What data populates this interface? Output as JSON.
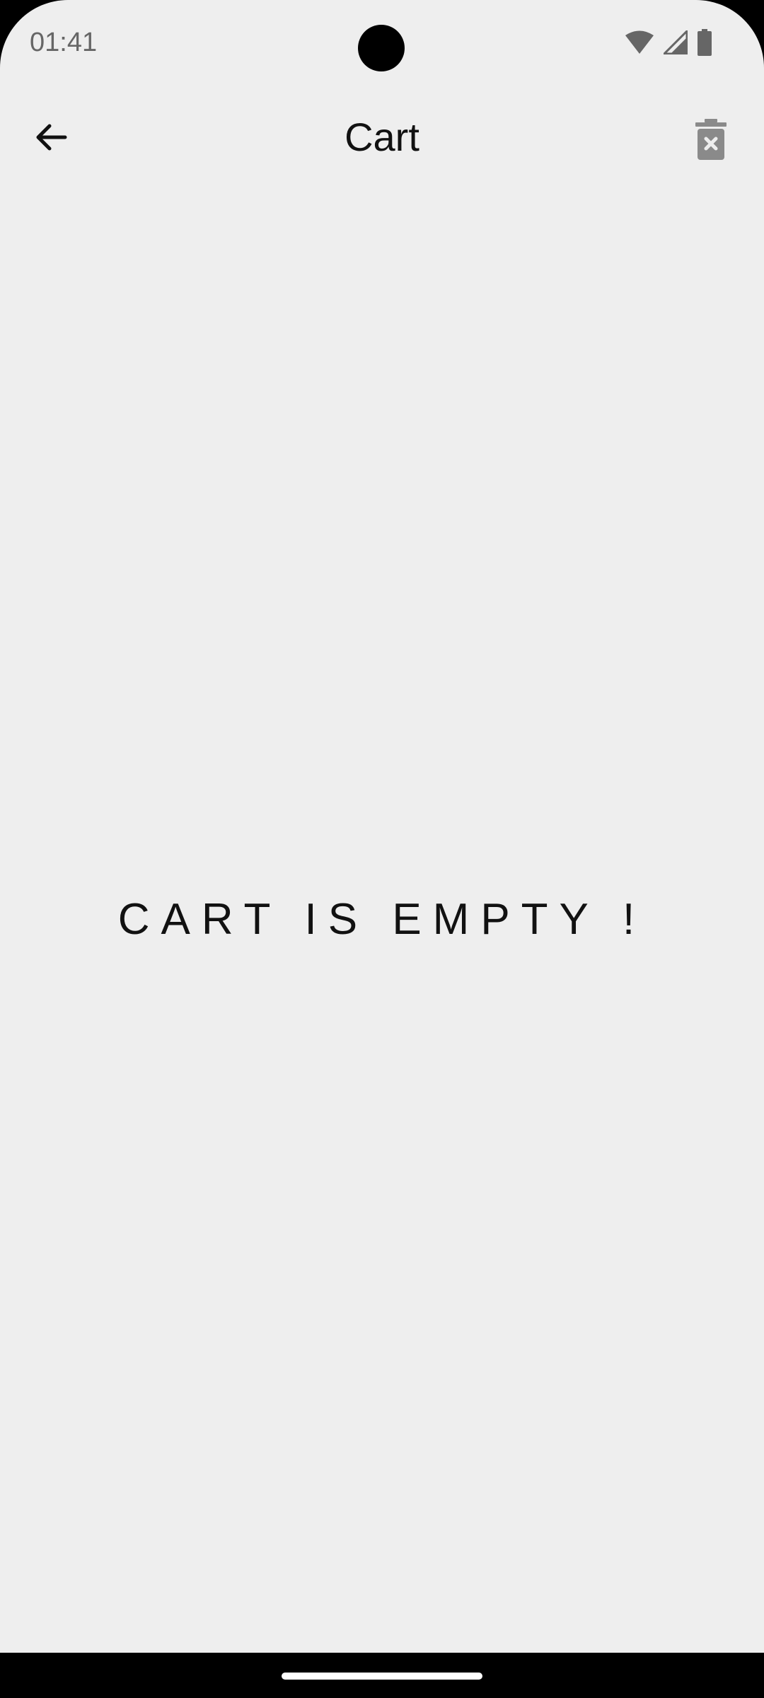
{
  "status_bar": {
    "time": "01:41",
    "icons": [
      "wifi-icon",
      "signal-icon",
      "battery-icon"
    ]
  },
  "app_bar": {
    "title": "Cart",
    "back_icon": "arrow-back-icon",
    "action_icon": "delete-cart-icon"
  },
  "main": {
    "empty_message": "CART IS EMPTY !"
  },
  "colors": {
    "background": "#eeeeee",
    "text": "#111111",
    "icon_gray": "#8a8a8a",
    "status_text": "#666666"
  }
}
